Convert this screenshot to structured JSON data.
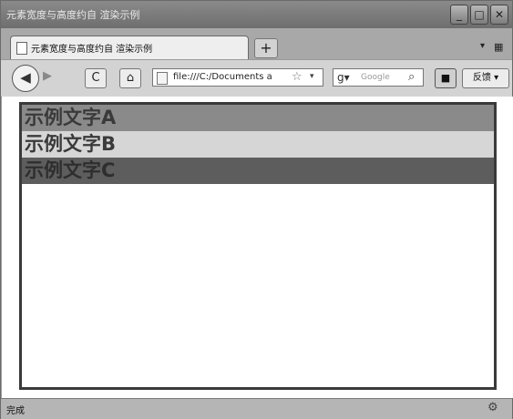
{
  "window": {
    "title": "元素宽度与高度约自 渲染示例"
  },
  "tab": {
    "title": "元素宽度与高度约自 渲染示例",
    "new_tab_symbol": "+"
  },
  "controls": {
    "minimize": "_",
    "maximize": "□",
    "close": "✕"
  },
  "nav": {
    "back_symbol": "◀",
    "forward_symbol": "▶",
    "reload_symbol": "C",
    "home_symbol": "⌂",
    "url": "file:///C:/Documents a",
    "search_placeholder": "Google",
    "feedback_label": "反馈"
  },
  "demo": {
    "rows": [
      {
        "label": "示例文字A"
      },
      {
        "label": "示例文字B"
      },
      {
        "label": "示例文字C"
      }
    ]
  },
  "status": {
    "text": "完成"
  },
  "icons": [
    "page-icon",
    "back-icon",
    "forward-icon",
    "reload-icon",
    "home-icon",
    "star-icon",
    "search-icon",
    "camera-icon"
  ]
}
